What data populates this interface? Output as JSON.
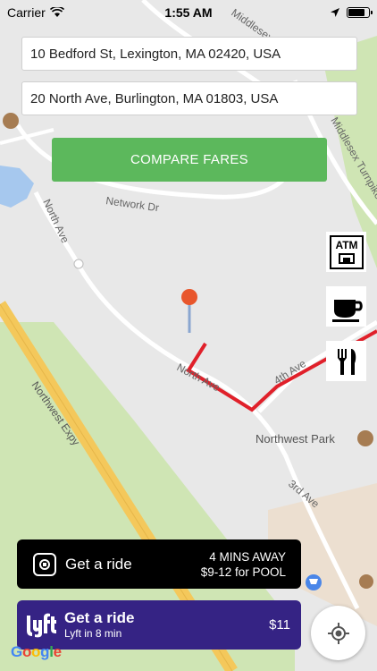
{
  "status_bar": {
    "carrier": "Carrier",
    "time": "1:55 AM"
  },
  "trip": {
    "from_value": "10 Bedford St, Lexington, MA 02420, USA",
    "to_value": "20 North Ave, Burlington, MA 01803, USA"
  },
  "compare_button_label": "COMPARE FARES",
  "map": {
    "road_labels": {
      "network_dr": "Network Dr",
      "north_ave_upper": "North Ave",
      "north_ave_lower": "North Ave",
      "fourth_ave": "4th Ave",
      "third_ave": "3rd Ave",
      "northwest_expy": "Northwest Expy",
      "middlesex_tpk": "Middlesex Turnpike",
      "middlesex_top": "Middlesex Tu"
    },
    "place_labels": {
      "northwest_park": "Northwest Park"
    },
    "colors": {
      "background": "#e8e8e8",
      "park": "#cfe5b4",
      "highway": "#f4c85b",
      "route": "#e0202a",
      "pin": "#e8562c",
      "water": "#a6c8ee"
    }
  },
  "poi_buttons": {
    "atm": "ATM"
  },
  "uber": {
    "cta": "Get a ride",
    "eta": "4 MINS AWAY",
    "price": "$9-12 for POOL",
    "color": "#000000"
  },
  "lyft": {
    "cta": "Get a ride",
    "eta": "Lyft in 8 min",
    "price": "$11",
    "color": "#352384"
  },
  "google": {
    "logo_text": "Google"
  }
}
